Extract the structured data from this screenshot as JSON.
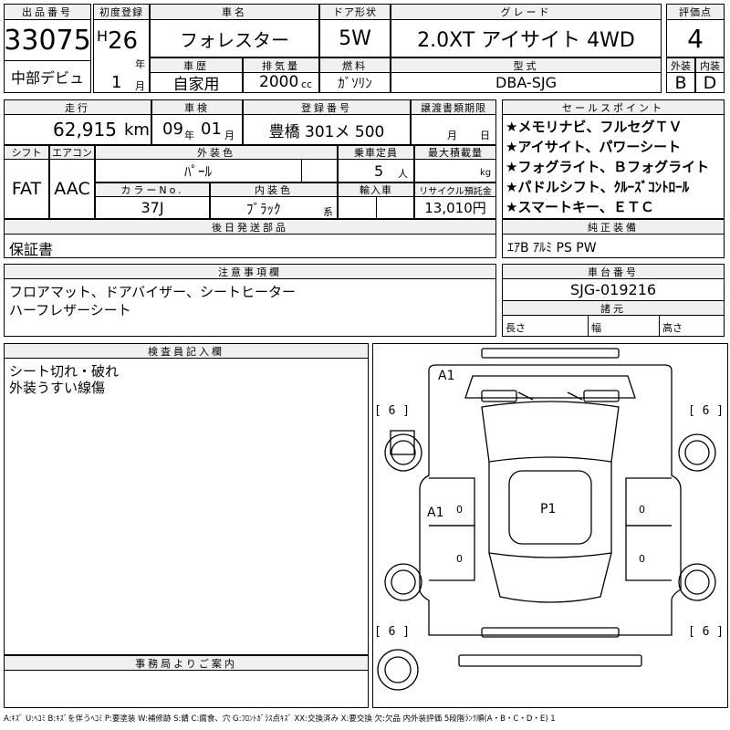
{
  "header": {
    "lot_no_label": "出品番号",
    "lot_no": "33075",
    "auction_name": "中部デビュ",
    "first_reg_label": "初度登録",
    "era": "H",
    "year": "26",
    "year_unit": "年",
    "month": "1",
    "month_unit": "月",
    "car_name_label": "車名",
    "car_name": "フォレスター",
    "door_label": "ドア形状",
    "door": "5W",
    "grade_label": "グレード",
    "grade": "2.0XT アイサイト 4WD",
    "score_label": "評価点",
    "score": "4",
    "history_label": "車歴",
    "history": "自家用",
    "displacement_label": "排気量",
    "displacement": "2000",
    "displacement_unit": "cc",
    "fuel_label": "燃料",
    "fuel": "ｶﾞｿﾘﾝ",
    "model_label": "型式",
    "model": "DBA-SJG",
    "exterior_label": "外装",
    "exterior_grade": "B",
    "interior_label": "内装",
    "interior_grade": "D"
  },
  "specs": {
    "mileage_label": "走行",
    "mileage": "62,915",
    "mileage_unit": "km",
    "inspection_label": "車検",
    "inspection_year": "09",
    "inspection_year_unit": "年",
    "inspection_month": "01",
    "inspection_month_unit": "月",
    "reg_no_label": "登録番号",
    "reg_no": "豊橋 301メ 500",
    "transfer_label": "譲渡書類期限",
    "transfer_month": "月",
    "transfer_day": "日",
    "shift_label": "シフト",
    "shift": "FAT",
    "ac_label": "エアコン",
    "ac": "AAC",
    "ext_color_label": "外装色",
    "ext_color": "ﾊﾟｰﾙ",
    "capacity_label": "乗車定員",
    "capacity": "5",
    "capacity_unit": "人",
    "max_load_label": "最大積載量",
    "max_load_unit": "kg",
    "color_no_label": "カラーNo.",
    "color_no": "37J",
    "int_color_label": "内装色",
    "int_color": "ﾌﾞﾗｯｸ",
    "int_color_unit": "系",
    "import_label": "輸入車",
    "recycle_label": "リサイクル預託金",
    "recycle": "13,010円"
  },
  "sales_points": {
    "label": "セールスポイント",
    "items": [
      "★メモリナビ、フルセグＴＶ",
      "★アイサイト、パワーシート",
      "★フォグライト、Ｂフォグライト",
      "★パドルシフト、ｸﾙｰｽﾞｺﾝﾄﾛｰﾙ",
      "★スマートキー、ＥＴＣ"
    ]
  },
  "later_parts": {
    "label": "後日発送部品",
    "value": "保証書"
  },
  "equipment": {
    "label": "純正装備",
    "value": "ｴｱB ｱﾙﾐ PS PW"
  },
  "notes": {
    "label": "注意事項欄",
    "lines": [
      "フロアマット、ドアバイザー、シートヒーター",
      "ハーフレザーシート"
    ]
  },
  "chassis": {
    "label": "車台番号",
    "value": "SJG-019216"
  },
  "dimensions": {
    "label": "諸元",
    "length_label": "長さ",
    "width_label": "幅",
    "height_label": "高さ"
  },
  "inspector": {
    "label": "検査員記入欄",
    "lines": [
      "シート切れ・破れ",
      "外装うすい線傷"
    ]
  },
  "office": {
    "label": "事務局よりご案内"
  },
  "diagram": {
    "marks": {
      "a1_front": "A1",
      "a1_side": "A1",
      "p1": "P1"
    },
    "tire_fl": "[ 6 ]",
    "tire_fr": "[ 6 ]",
    "tire_rl": "[ 6 ]",
    "tire_rr": "[ 6 ]",
    "zero_1": "0",
    "zero_2": "0",
    "zero_3": "0",
    "zero_4": "0"
  },
  "legend": "A:ｷｽﾞ U:ﾍｺﾐ B:ｷｽﾞを伴うﾍｺﾐ P:要塗装 W:補修跡 S:錆 C:腐食、穴 G:ﾌﾛﾝﾄｶﾞﾗｽ点ｷｽﾞ XX:交換済み X:要交換 欠:欠品 内外装評価 5段階ﾗﾝｸ順(A・B・C・D・E) 1"
}
